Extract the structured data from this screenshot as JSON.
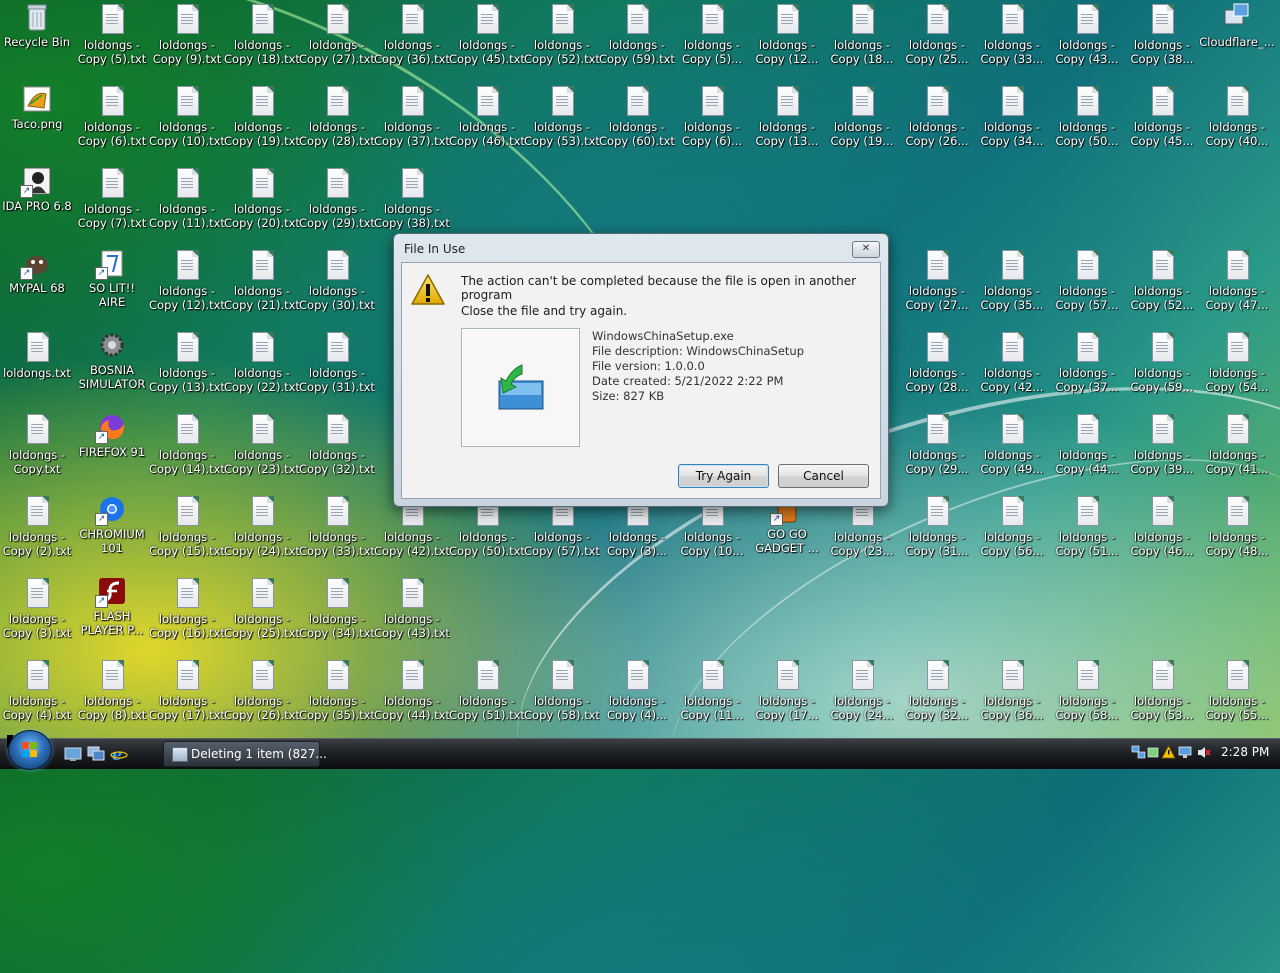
{
  "desktop": {
    "icons": [
      {
        "label": "Recycle Bin",
        "kind": "recycle",
        "col": 0,
        "row": 0
      },
      {
        "label": "Taco.png",
        "kind": "image",
        "col": 0,
        "row": 1
      },
      {
        "label": "IDA PRO 6.8",
        "kind": "app-ida",
        "col": 0,
        "row": 2
      },
      {
        "label": "MYPAL 68",
        "kind": "app-mypal",
        "col": 0,
        "row": 3
      },
      {
        "label": "loldongs.txt",
        "kind": "txt",
        "col": 0,
        "row": 4
      },
      {
        "label": "loldongs - Copy.txt",
        "kind": "txt",
        "col": 0,
        "row": 5
      },
      {
        "label": "loldongs - Copy (2).txt",
        "kind": "txt",
        "col": 0,
        "row": 6
      },
      {
        "label": "loldongs - Copy (3).txt",
        "kind": "txt",
        "col": 0,
        "row": 7
      },
      {
        "label": "loldongs - Copy (4).txt",
        "kind": "txt",
        "col": 0,
        "row": 8
      },
      {
        "label": "loldongs - Copy (5).txt",
        "kind": "txt",
        "col": 1,
        "row": 0
      },
      {
        "label": "loldongs - Copy (6).txt",
        "kind": "txt",
        "col": 1,
        "row": 1
      },
      {
        "label": "loldongs - Copy (7).txt",
        "kind": "txt",
        "col": 1,
        "row": 2
      },
      {
        "label": "SO LIT!! AIRE",
        "kind": "app-solit",
        "col": 1,
        "row": 3
      },
      {
        "label": "BOSNIA SIMULATOR",
        "kind": "app-bosnia",
        "col": 1,
        "row": 4
      },
      {
        "label": "FIREFOX 91",
        "kind": "app-firefox",
        "col": 1,
        "row": 5
      },
      {
        "label": "CHROMIUM 101",
        "kind": "app-chromium",
        "col": 1,
        "row": 6
      },
      {
        "label": "FLASH PLAYER P...",
        "kind": "app-flash",
        "col": 1,
        "row": 7
      },
      {
        "label": "loldongs - Copy (8).txt",
        "kind": "txt",
        "col": 1,
        "row": 8
      },
      {
        "label": "loldongs - Copy (9).txt",
        "kind": "txt",
        "col": 2,
        "row": 0
      },
      {
        "label": "loldongs - Copy (10).txt",
        "kind": "txt",
        "col": 2,
        "row": 1
      },
      {
        "label": "loldongs - Copy (11).txt",
        "kind": "txt",
        "col": 2,
        "row": 2
      },
      {
        "label": "loldongs - Copy (12).txt",
        "kind": "txt",
        "col": 2,
        "row": 3
      },
      {
        "label": "loldongs - Copy (13).txt",
        "kind": "txt",
        "col": 2,
        "row": 4
      },
      {
        "label": "loldongs - Copy (14).txt",
        "kind": "txt",
        "col": 2,
        "row": 5
      },
      {
        "label": "loldongs - Copy (15).txt",
        "kind": "txt",
        "col": 2,
        "row": 6
      },
      {
        "label": "loldongs - Copy (16).txt",
        "kind": "txt",
        "col": 2,
        "row": 7
      },
      {
        "label": "loldongs - Copy (17).txt",
        "kind": "txt",
        "col": 2,
        "row": 8
      },
      {
        "label": "loldongs - Copy (18).txt",
        "kind": "txt",
        "col": 3,
        "row": 0
      },
      {
        "label": "loldongs - Copy (19).txt",
        "kind": "txt",
        "col": 3,
        "row": 1
      },
      {
        "label": "loldongs - Copy (20).txt",
        "kind": "txt",
        "col": 3,
        "row": 2
      },
      {
        "label": "loldongs - Copy (21).txt",
        "kind": "txt",
        "col": 3,
        "row": 3
      },
      {
        "label": "loldongs - Copy (22).txt",
        "kind": "txt",
        "col": 3,
        "row": 4
      },
      {
        "label": "loldongs - Copy (23).txt",
        "kind": "txt",
        "col": 3,
        "row": 5
      },
      {
        "label": "loldongs - Copy (24).txt",
        "kind": "txt",
        "col": 3,
        "row": 6
      },
      {
        "label": "loldongs - Copy (25).txt",
        "kind": "txt",
        "col": 3,
        "row": 7
      },
      {
        "label": "loldongs - Copy (26).txt",
        "kind": "txt",
        "col": 3,
        "row": 8
      },
      {
        "label": "loldongs - Copy (27).txt",
        "kind": "txt",
        "col": 4,
        "row": 0
      },
      {
        "label": "loldongs - Copy (28).txt",
        "kind": "txt",
        "col": 4,
        "row": 1
      },
      {
        "label": "loldongs - Copy (29).txt",
        "kind": "txt",
        "col": 4,
        "row": 2
      },
      {
        "label": "loldongs - Copy (30).txt",
        "kind": "txt",
        "col": 4,
        "row": 3
      },
      {
        "label": "loldongs - Copy (31).txt",
        "kind": "txt",
        "col": 4,
        "row": 4
      },
      {
        "label": "loldongs - Copy (32).txt",
        "kind": "txt",
        "col": 4,
        "row": 5
      },
      {
        "label": "loldongs - Copy (33).txt",
        "kind": "txt",
        "col": 4,
        "row": 6
      },
      {
        "label": "loldongs - Copy (34).txt",
        "kind": "txt",
        "col": 4,
        "row": 7
      },
      {
        "label": "loldongs - Copy (35).txt",
        "kind": "txt",
        "col": 4,
        "row": 8
      },
      {
        "label": "loldongs - Copy (36).txt",
        "kind": "txt",
        "col": 5,
        "row": 0
      },
      {
        "label": "loldongs - Copy (37).txt",
        "kind": "txt",
        "col": 5,
        "row": 1
      },
      {
        "label": "loldongs - Copy (38).txt",
        "kind": "txt",
        "col": 5,
        "row": 2
      },
      {
        "label": "loldongs - Copy (42).txt",
        "kind": "txt",
        "col": 5,
        "row": 6
      },
      {
        "label": "loldongs - Copy (43).txt",
        "kind": "txt",
        "col": 5,
        "row": 7
      },
      {
        "label": "loldongs - Copy (44).txt",
        "kind": "txt",
        "col": 5,
        "row": 8
      },
      {
        "label": "loldongs - Copy (45).txt",
        "kind": "txt",
        "col": 6,
        "row": 0
      },
      {
        "label": "loldongs - Copy (46).txt",
        "kind": "txt",
        "col": 6,
        "row": 1
      },
      {
        "label": "loldongs - Copy (50).txt",
        "kind": "txt",
        "col": 6,
        "row": 6
      },
      {
        "label": "loldongs - Copy (51).txt",
        "kind": "txt",
        "col": 6,
        "row": 8
      },
      {
        "label": "loldongs - Copy (52).txt",
        "kind": "txt",
        "col": 7,
        "row": 0
      },
      {
        "label": "loldongs - Copy (53).txt",
        "kind": "txt",
        "col": 7,
        "row": 1
      },
      {
        "label": "loldongs - Copy (57).txt",
        "kind": "txt",
        "col": 7,
        "row": 6
      },
      {
        "label": "loldongs - Copy (58).txt",
        "kind": "txt",
        "col": 7,
        "row": 8
      },
      {
        "label": "loldongs - Copy (59).txt",
        "kind": "txt",
        "col": 8,
        "row": 0
      },
      {
        "label": "loldongs - Copy (60).txt",
        "kind": "txt",
        "col": 8,
        "row": 1
      },
      {
        "label": "loldongs - Copy (3)...",
        "kind": "txt",
        "col": 8,
        "row": 6
      },
      {
        "label": "loldongs - Copy (4)...",
        "kind": "txt",
        "col": 8,
        "row": 8
      },
      {
        "label": "loldongs - Copy (5)...",
        "kind": "txt",
        "col": 9,
        "row": 0
      },
      {
        "label": "loldongs - Copy (6)...",
        "kind": "txt",
        "col": 9,
        "row": 1
      },
      {
        "label": "loldongs - Copy (10...",
        "kind": "txt",
        "col": 9,
        "row": 6
      },
      {
        "label": "loldongs - Copy (11...",
        "kind": "txt",
        "col": 9,
        "row": 8
      },
      {
        "label": "loldongs - Copy (12...",
        "kind": "txt",
        "col": 10,
        "row": 0
      },
      {
        "label": "loldongs - Copy (13...",
        "kind": "txt",
        "col": 10,
        "row": 1
      },
      {
        "label": "GO GO GADGET ...",
        "kind": "app-gogo",
        "col": 10,
        "row": 6
      },
      {
        "label": "loldongs - Copy (17...",
        "kind": "txt",
        "col": 10,
        "row": 8
      },
      {
        "label": "loldongs - Copy (18...",
        "kind": "txt",
        "col": 11,
        "row": 0
      },
      {
        "label": "loldongs - Copy (19...",
        "kind": "txt",
        "col": 11,
        "row": 1
      },
      {
        "label": "loldongs - Copy (23...",
        "kind": "txt",
        "col": 11,
        "row": 6
      },
      {
        "label": "loldongs - Copy (24...",
        "kind": "txt",
        "col": 11,
        "row": 8
      },
      {
        "label": "loldongs - Copy (25...",
        "kind": "txt",
        "col": 12,
        "row": 0
      },
      {
        "label": "loldongs - Copy (26...",
        "kind": "txt",
        "col": 12,
        "row": 1
      },
      {
        "label": "loldongs - Copy (27...",
        "kind": "txt",
        "col": 12,
        "row": 3
      },
      {
        "label": "loldongs - Copy (28...",
        "kind": "txt",
        "col": 12,
        "row": 4
      },
      {
        "label": "loldongs - Copy (29...",
        "kind": "txt",
        "col": 12,
        "row": 5
      },
      {
        "label": "loldongs - Copy (31...",
        "kind": "txt",
        "col": 12,
        "row": 6
      },
      {
        "label": "loldongs - Copy (32...",
        "kind": "txt",
        "col": 12,
        "row": 8
      },
      {
        "label": "loldongs - Copy (33...",
        "kind": "txt",
        "col": 13,
        "row": 0
      },
      {
        "label": "loldongs - Copy (34...",
        "kind": "txt",
        "col": 13,
        "row": 1
      },
      {
        "label": "loldongs - Copy (35...",
        "kind": "txt",
        "col": 13,
        "row": 3
      },
      {
        "label": "loldongs - Copy (42...",
        "kind": "txt",
        "col": 13,
        "row": 4
      },
      {
        "label": "loldongs - Copy (49...",
        "kind": "txt",
        "col": 13,
        "row": 5
      },
      {
        "label": "loldongs - Copy (56...",
        "kind": "txt",
        "col": 13,
        "row": 6
      },
      {
        "label": "loldongs - Copy (36...",
        "kind": "txt",
        "col": 13,
        "row": 8
      },
      {
        "label": "loldongs - Copy (43...",
        "kind": "txt",
        "col": 14,
        "row": 0
      },
      {
        "label": "loldongs - Copy (50...",
        "kind": "txt",
        "col": 14,
        "row": 1
      },
      {
        "label": "loldongs - Copy (57...",
        "kind": "txt",
        "col": 14,
        "row": 3
      },
      {
        "label": "loldongs - Copy (37...",
        "kind": "txt",
        "col": 14,
        "row": 4
      },
      {
        "label": "loldongs - Copy (44...",
        "kind": "txt",
        "col": 14,
        "row": 5
      },
      {
        "label": "loldongs - Copy (51...",
        "kind": "txt",
        "col": 14,
        "row": 6
      },
      {
        "label": "loldongs - Copy (58...",
        "kind": "txt",
        "col": 14,
        "row": 8
      },
      {
        "label": "loldongs - Copy (38...",
        "kind": "txt",
        "col": 15,
        "row": 0
      },
      {
        "label": "loldongs - Copy (45...",
        "kind": "txt",
        "col": 15,
        "row": 1
      },
      {
        "label": "loldongs - Copy (52...",
        "kind": "txt",
        "col": 15,
        "row": 3
      },
      {
        "label": "loldongs - Copy (59...",
        "kind": "txt",
        "col": 15,
        "row": 4
      },
      {
        "label": "loldongs - Copy (39...",
        "kind": "txt",
        "col": 15,
        "row": 5
      },
      {
        "label": "loldongs - Copy (46...",
        "kind": "txt",
        "col": 15,
        "row": 6
      },
      {
        "label": "loldongs - Copy (53...",
        "kind": "txt",
        "col": 15,
        "row": 8
      },
      {
        "label": "Cloudflare_...",
        "kind": "app-cloudflare",
        "col": 16,
        "row": 0
      },
      {
        "label": "loldongs - Copy (40...",
        "kind": "txt",
        "col": 16,
        "row": 1
      },
      {
        "label": "loldongs - Copy (47...",
        "kind": "txt",
        "col": 16,
        "row": 3
      },
      {
        "label": "loldongs - Copy (54...",
        "kind": "txt",
        "col": 16,
        "row": 4
      },
      {
        "label": "loldongs - Copy (41...",
        "kind": "txt",
        "col": 16,
        "row": 5
      },
      {
        "label": "loldongs - Copy (48...",
        "kind": "txt",
        "col": 16,
        "row": 6
      },
      {
        "label": "loldongs - Copy (55...",
        "kind": "txt",
        "col": 16,
        "row": 8
      }
    ]
  },
  "dialog": {
    "title": "File In Use",
    "close_glyph": "✕",
    "message": "The action can't be completed because the file is open in another program",
    "instruction": "Close the file and try again.",
    "file": {
      "name": "WindowsChinaSetup.exe",
      "description": "File description: WindowsChinaSetup",
      "version": "File version: 1.0.0.0",
      "created": "Date created: 5/21/2022 2:22 PM",
      "size": "Size: 827 KB"
    },
    "buttons": {
      "try_again": "Try Again",
      "cancel": "Cancel"
    },
    "warning_color": "#f2c200",
    "focus_color": "#3c7fb1"
  },
  "taskbar": {
    "start_icon": "windows-orb-icon",
    "quicklaunch": [
      "show-desktop-icon",
      "switch-windows-icon",
      "internet-explorer-icon"
    ],
    "task_button": "Deleting 1 item (827...",
    "tray": [
      "network-icon",
      "usb-icon",
      "security-alert-icon",
      "monitor-icon",
      "volume-muted-icon"
    ],
    "clock": "2:28 PM"
  }
}
